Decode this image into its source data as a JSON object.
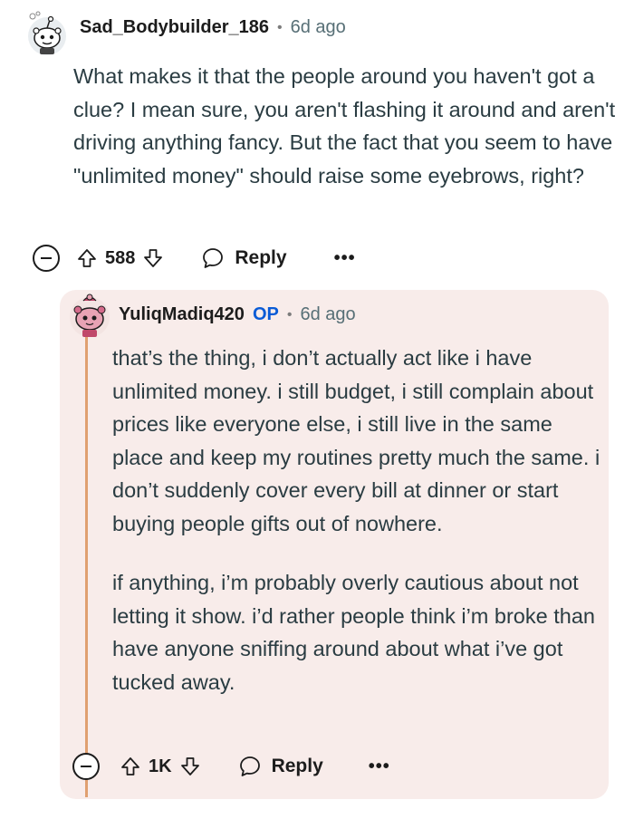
{
  "comment": {
    "username": "Sad_Bodybuilder_186",
    "separator": "•",
    "time_ago": "6d ago",
    "body": "What makes it that the people around you haven't got a clue? I mean sure, you aren't flashing it around and aren't driving anything fancy. But the fact that you seem to have \"unlimited money\" should raise some eyebrows, right?",
    "score": "588",
    "reply_label": "Reply",
    "more_label": "•••"
  },
  "reply": {
    "username": "YuliqMadiq420",
    "op_tag": "OP",
    "separator": "•",
    "time_ago": "6d ago",
    "paragraphs": [
      "that’s the thing, i don’t actually act like i have unlimited money. i still budget, i still complain about prices like everyone else, i still live in the same place and keep my routines pretty much the same. i don’t suddenly cover every bill at dinner or start buying people gifts out of nowhere.",
      "if anything, i’m probably overly cautious about not letting it show. i’d rather people think i’m broke than have anyone sniffing around about what i’ve got tucked away."
    ],
    "score": "1K",
    "reply_label": "Reply",
    "more_label": "•••"
  },
  "colors": {
    "highlight_bg": "#f8ecea",
    "thread_line": "#e0a070",
    "op_blue": "#0a5bd6",
    "meta_gray": "#576f76"
  }
}
